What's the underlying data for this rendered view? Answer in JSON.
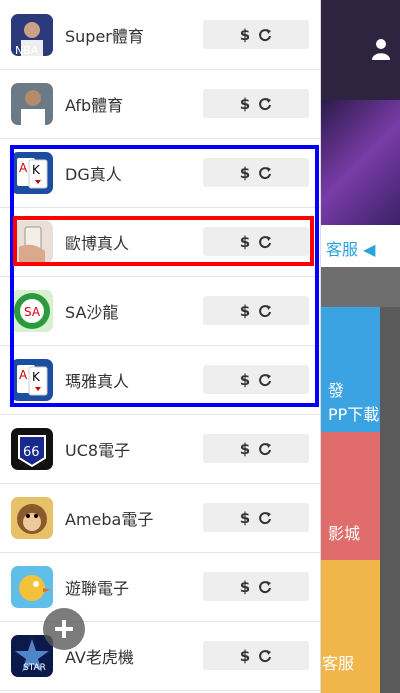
{
  "background": {
    "customer_service": "客服 ◀",
    "tile_blue_label": "發\nPP下載",
    "tile_red_label": "影城",
    "tile_yellow_label": "客服"
  },
  "games": [
    {
      "name": "Super體育",
      "icon": "nba-player-icon",
      "btn": "$"
    },
    {
      "name": "Afb體育",
      "icon": "soccer-player-icon",
      "btn": "$"
    },
    {
      "name": "DG真人",
      "icon": "playing-cards-icon",
      "btn": "$"
    },
    {
      "name": "歐博真人",
      "icon": "card-hand-icon",
      "btn": "$"
    },
    {
      "name": "SA沙龍",
      "icon": "casino-chip-icon",
      "btn": "$"
    },
    {
      "name": "瑪雅真人",
      "icon": "playing-cards-icon",
      "btn": "$"
    },
    {
      "name": "UC8電子",
      "icon": "route-66-icon",
      "btn": "$"
    },
    {
      "name": "Ameba電子",
      "icon": "monkey-icon",
      "btn": "$"
    },
    {
      "name": "遊聯電子",
      "icon": "bird-icon",
      "btn": "$"
    },
    {
      "name": "AV老虎機",
      "icon": "star-logo-icon",
      "btn": "$"
    }
  ],
  "colors": {
    "highlight_group": "#0000ff",
    "highlight_item": "#ff0000"
  }
}
